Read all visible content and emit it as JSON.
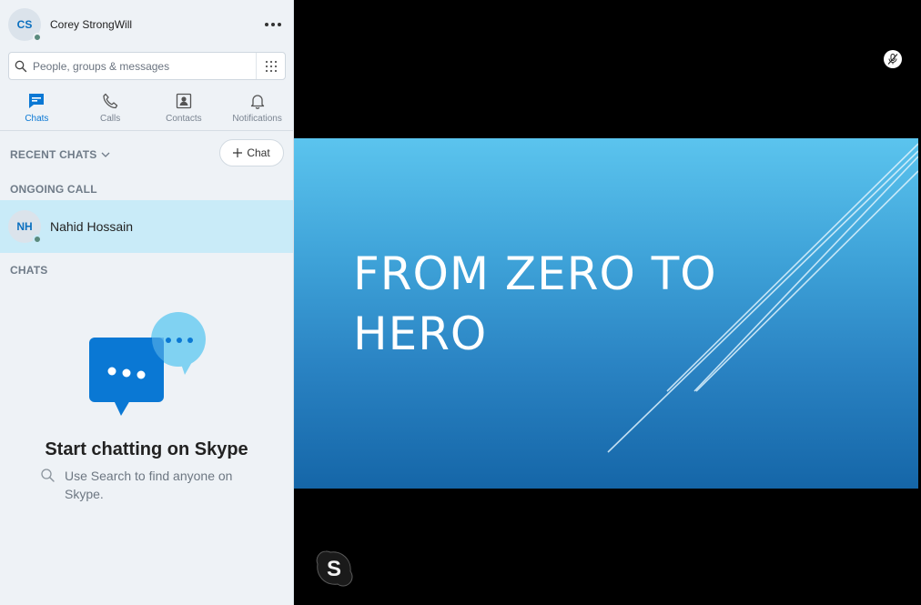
{
  "profile": {
    "initials": "CS",
    "name": "Corey StrongWill"
  },
  "search": {
    "placeholder": "People, groups & messages"
  },
  "tabs": [
    {
      "label": "Chats",
      "icon": "chat-icon",
      "active": true
    },
    {
      "label": "Calls",
      "icon": "phone-icon",
      "active": false
    },
    {
      "label": "Contacts",
      "icon": "contacts-icon",
      "active": false
    },
    {
      "label": "Notifications",
      "icon": "bell-icon",
      "active": false
    }
  ],
  "recent_chats": {
    "label": "RECENT CHATS",
    "new_chat_label": "Chat"
  },
  "ongoing_call": {
    "label": "ONGOING CALL",
    "initials": "NH",
    "name": "Nahid Hossain"
  },
  "chats": {
    "label": "CHATS"
  },
  "empty_state": {
    "title": "Start chatting on Skype",
    "hint": "Use Search to find anyone on Skype."
  },
  "slide": {
    "line1": "FROM ZERO TO",
    "line2": "HERO"
  },
  "colors": {
    "accent": "#0a78d4",
    "call_row": "#c9ebf8",
    "sidebar": "#eef2f6"
  }
}
